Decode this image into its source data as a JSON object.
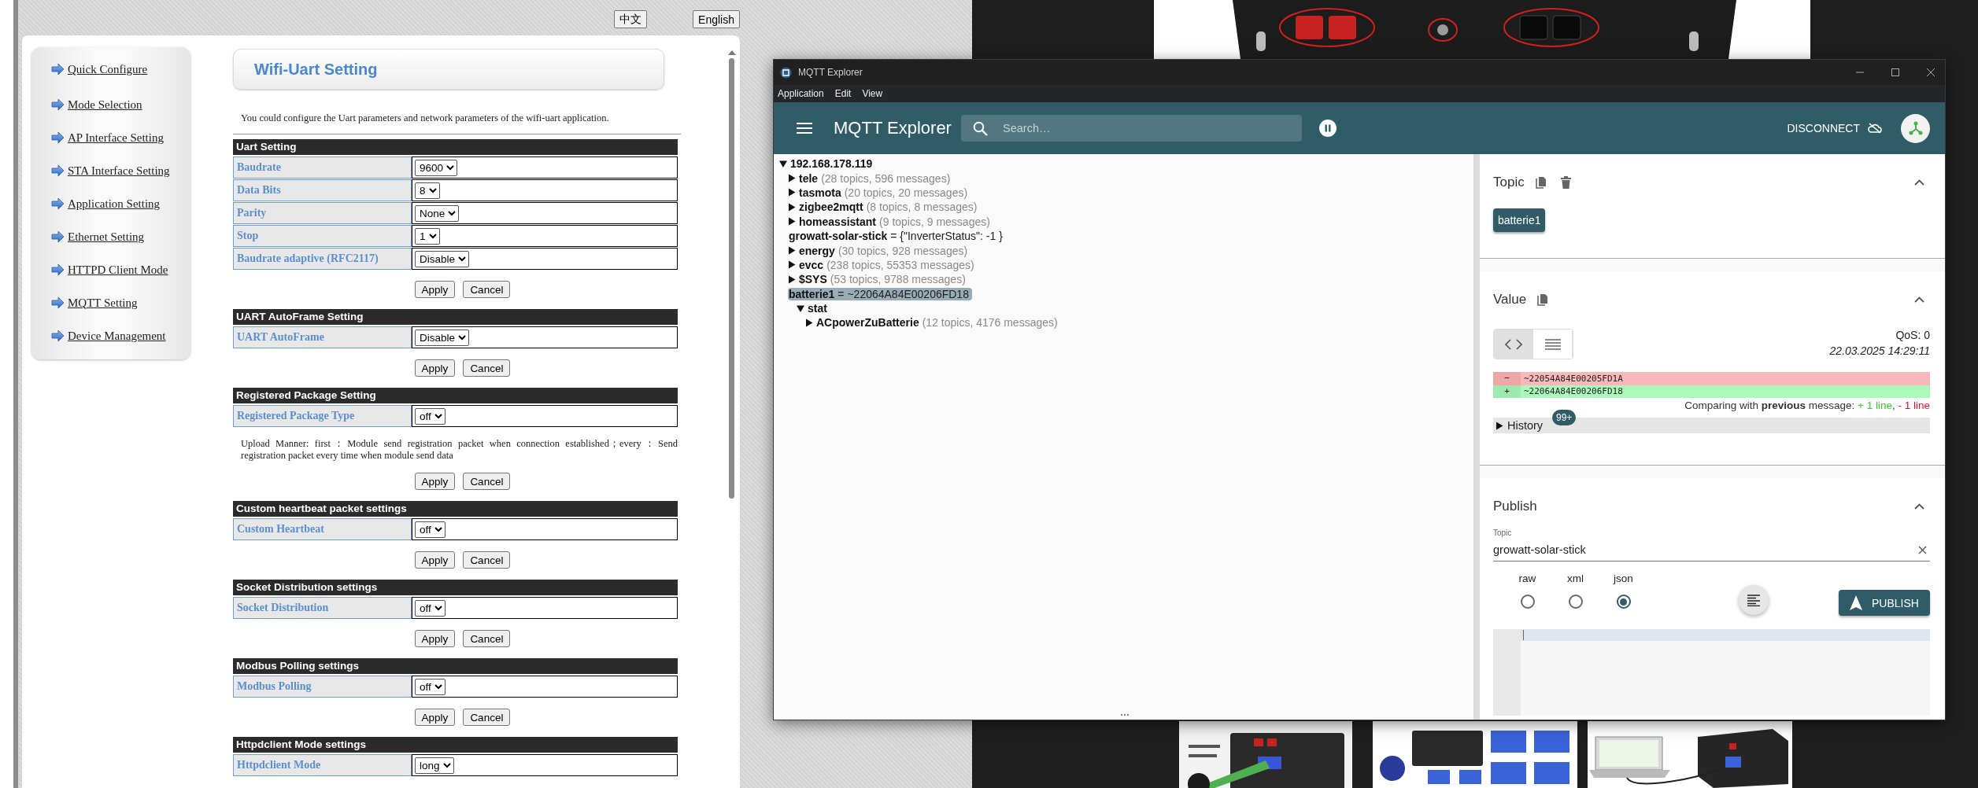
{
  "browser": {
    "language_buttons": [
      "中文",
      "English"
    ],
    "nav_items": [
      "Quick Configure",
      "Mode Selection",
      "AP Interface Setting",
      "STA Interface Setting",
      "Application Setting",
      "Ethernet Setting",
      "HTTPD Client Mode",
      "MQTT Setting",
      "Device Management"
    ],
    "title": "Wifi-Uart Setting",
    "description": "You could configure the Uart parameters and network parameters of the wifi-uart application.",
    "sections": [
      {
        "heading": "Uart Setting",
        "rows": [
          {
            "label": "Baudrate",
            "value": "9600"
          },
          {
            "label": "Data Bits",
            "value": "8"
          },
          {
            "label": "Parity",
            "value": "None"
          },
          {
            "label": "Stop",
            "value": "1"
          },
          {
            "label": "Baudrate adaptive (RFC2117)",
            "value": "Disable"
          }
        ],
        "buttons": [
          "Apply",
          "Cancel"
        ]
      },
      {
        "heading": "UART AutoFrame Setting",
        "rows": [
          {
            "label": "UART AutoFrame",
            "value": "Disable"
          }
        ],
        "buttons": [
          "Apply",
          "Cancel"
        ]
      },
      {
        "heading": "Registered Package Setting",
        "rows": [
          {
            "label": "Registered Package Type",
            "value": "off"
          }
        ],
        "note": "Upload Manner: first：Module send registration packet when connection established；every：Send registration packet every time when module send data",
        "buttons": [
          "Apply",
          "Cancel"
        ]
      },
      {
        "heading": "Custom heartbeat packet settings",
        "rows": [
          {
            "label": "Custom Heartbeat",
            "value": "off"
          }
        ],
        "buttons": [
          "Apply",
          "Cancel"
        ]
      },
      {
        "heading": "Socket Distribution settings",
        "rows": [
          {
            "label": "Socket Distribution",
            "value": "off"
          }
        ],
        "buttons": [
          "Apply",
          "Cancel"
        ]
      },
      {
        "heading": "Modbus Polling settings",
        "rows": [
          {
            "label": "Modbus Polling",
            "value": "off"
          }
        ],
        "buttons": [
          "Apply",
          "Cancel"
        ]
      },
      {
        "heading": "Httpdclient Mode settings",
        "rows": [
          {
            "label": "Httpdclient Mode",
            "value": "long"
          }
        ]
      }
    ]
  },
  "mqtt": {
    "window_title": "MQTT Explorer",
    "menu": [
      "Application",
      "Edit",
      "View"
    ],
    "app_title": "MQTT Explorer",
    "search_placeholder": "Search…",
    "disconnect": "DISCONNECT",
    "tree": {
      "label": "192.168.178.119",
      "expanded": true,
      "selected": false,
      "children": [
        {
          "label": "tele",
          "summary": "(28 topics, 596 messages)",
          "expanded": false,
          "selected": false
        },
        {
          "label": "tasmota",
          "summary": "(20 topics, 20 messages)",
          "expanded": false,
          "selected": false
        },
        {
          "label": "zigbee2mqtt",
          "summary": "(8 topics, 8 messages)",
          "expanded": false,
          "selected": false
        },
        {
          "label": "homeassistant",
          "summary": "(9 topics, 9 messages)",
          "expanded": false,
          "selected": false
        },
        {
          "label": "growatt-solar-stick",
          "value": "= {\"InverterStatus\": -1 }",
          "selected": false
        },
        {
          "label": "energy",
          "summary": "(30 topics, 928 messages)",
          "expanded": false,
          "selected": false
        },
        {
          "label": "evcc",
          "summary": "(238 topics, 55353 messages)",
          "expanded": false,
          "selected": false
        },
        {
          "label": "$SYS",
          "summary": "(53 topics, 9788 messages)",
          "expanded": false,
          "selected": false
        },
        {
          "label": "batterie1",
          "value": "= ~22064A84E00206FD18",
          "selected": true,
          "children": [
            {
              "label": "stat",
              "expanded": true,
              "selected": false,
              "children": [
                {
                  "label": "ACpowerZuBatterie",
                  "summary": "(12 topics, 4176 messages)",
                  "expanded": false,
                  "selected": false
                }
              ]
            }
          ]
        }
      ]
    },
    "topic_section": {
      "title": "Topic",
      "expanded": true,
      "chip": "batterie1"
    },
    "value_section": {
      "title": "Value",
      "expanded": true,
      "view_modes": [
        {
          "kind": "code",
          "selected": true
        },
        {
          "kind": "list",
          "selected": false
        }
      ],
      "qos": "QoS: 0",
      "timestamp": "22.03.2025 14:29:11",
      "diff": [
        {
          "kind": "removed",
          "sign": "−",
          "text": "~22054A84E00205FD1A"
        },
        {
          "kind": "added",
          "sign": "+",
          "text": "~22064A84E00206FD18"
        }
      ],
      "comparison": {
        "text": "Comparing with **previous** message:",
        "added": "+ 1 line",
        "separator": ",",
        "removed": "- 1 line"
      },
      "history": {
        "label": "History",
        "expanded": false,
        "badge": "99+"
      }
    },
    "publish_section": {
      "title": "Publish",
      "expanded": true,
      "topic_label": "Topic",
      "topic_value": "growatt-solar-stick",
      "formats": [
        {
          "label": "raw",
          "selected": false
        },
        {
          "label": "xml",
          "selected": false
        },
        {
          "label": "json",
          "selected": true
        }
      ],
      "button": "PUBLISH"
    }
  }
}
